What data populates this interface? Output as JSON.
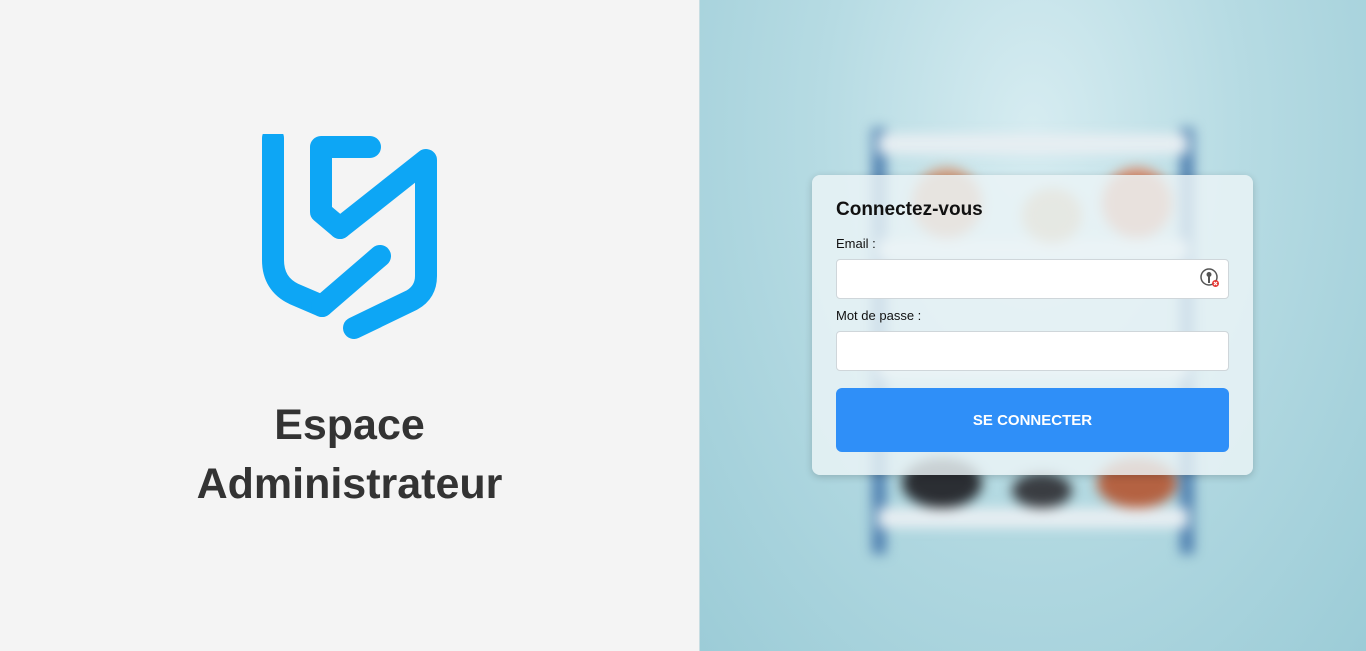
{
  "brand": {
    "logo_icon": "shield-s-logo-icon",
    "accent_color": "#0da6f5"
  },
  "left": {
    "heading_line1": "Espace",
    "heading_line2": "Administrateur"
  },
  "login": {
    "title": "Connectez-vous",
    "email_label": "Email :",
    "email_value": "",
    "password_label": "Mot de passe :",
    "password_value": "",
    "password_manager_icon": "password-manager-key-icon",
    "submit_label": "SE CONNECTER",
    "button_color": "#2f8ff8"
  }
}
